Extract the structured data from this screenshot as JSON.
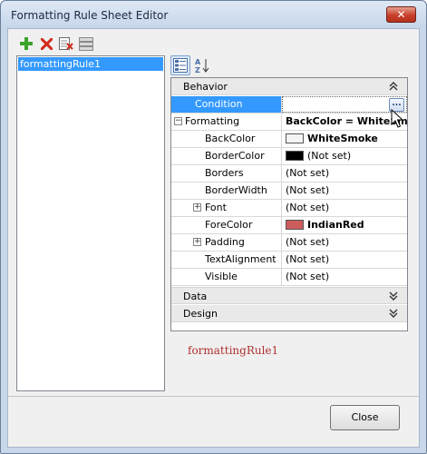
{
  "window": {
    "title": "Formatting Rule Sheet Editor",
    "close_glyph": "✕"
  },
  "toolbar": {
    "buttons": [
      {
        "icon": "add-icon"
      },
      {
        "icon": "delete-icon"
      },
      {
        "icon": "clear-icon"
      },
      {
        "icon": "purge-icon"
      }
    ]
  },
  "rules_list": {
    "items": [
      "formattingRule1"
    ]
  },
  "property_grid": {
    "categories": {
      "behavior": "Behavior",
      "data": "Data",
      "design": "Design"
    },
    "rows": [
      {
        "name": "Condition",
        "value": "",
        "selected": true,
        "ellipsis": "..."
      },
      {
        "name": "Formatting",
        "value": "BackColor = WhiteSmo"
      },
      {
        "name": "BackColor",
        "value": "WhiteSmoke",
        "swatch": "#f5f5f5"
      },
      {
        "name": "BorderColor",
        "value": "(Not set)",
        "swatch": "#000000"
      },
      {
        "name": "Borders",
        "value": "(Not set)"
      },
      {
        "name": "BorderWidth",
        "value": "(Not set)"
      },
      {
        "name": "Font",
        "value": "(Not set)"
      },
      {
        "name": "ForeColor",
        "value": "IndianRed",
        "swatch": "#cd5c5c"
      },
      {
        "name": "Padding",
        "value": "(Not set)"
      },
      {
        "name": "TextAlignment",
        "value": "(Not set)"
      },
      {
        "name": "Visible",
        "value": "(Not set)"
      }
    ],
    "expander_glyphs": {
      "minus": "−",
      "plus": "+"
    }
  },
  "preview": {
    "text": "formattingRule1"
  },
  "buttons": {
    "close": "Close"
  },
  "colors": {
    "selection": "#3399ff",
    "preview_text": "#b03030"
  }
}
